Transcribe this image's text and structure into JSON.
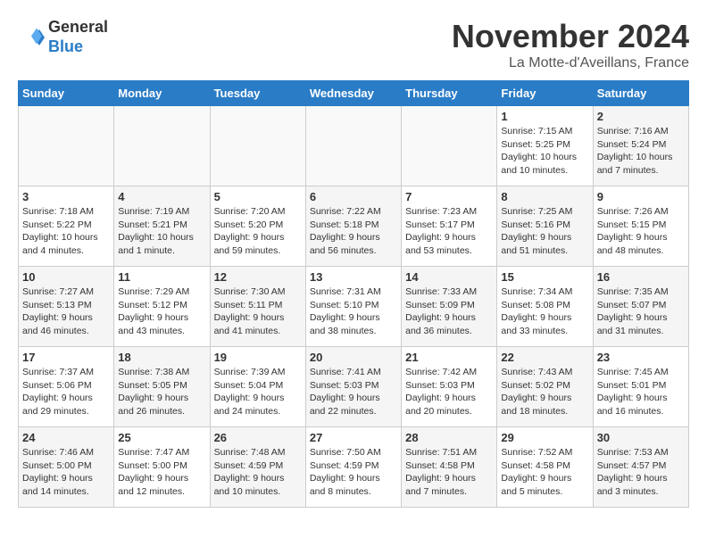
{
  "logo": {
    "general": "General",
    "blue": "Blue"
  },
  "title": "November 2024",
  "subtitle": "La Motte-d'Aveillans, France",
  "days_of_week": [
    "Sunday",
    "Monday",
    "Tuesday",
    "Wednesday",
    "Thursday",
    "Friday",
    "Saturday"
  ],
  "weeks": [
    [
      {
        "num": "",
        "info": "",
        "empty": true
      },
      {
        "num": "",
        "info": "",
        "empty": true
      },
      {
        "num": "",
        "info": "",
        "empty": true
      },
      {
        "num": "",
        "info": "",
        "empty": true
      },
      {
        "num": "",
        "info": "",
        "empty": true
      },
      {
        "num": "1",
        "info": "Sunrise: 7:15 AM\nSunset: 5:25 PM\nDaylight: 10 hours and 10 minutes."
      },
      {
        "num": "2",
        "info": "Sunrise: 7:16 AM\nSunset: 5:24 PM\nDaylight: 10 hours and 7 minutes."
      }
    ],
    [
      {
        "num": "3",
        "info": "Sunrise: 7:18 AM\nSunset: 5:22 PM\nDaylight: 10 hours and 4 minutes."
      },
      {
        "num": "4",
        "info": "Sunrise: 7:19 AM\nSunset: 5:21 PM\nDaylight: 10 hours and 1 minute."
      },
      {
        "num": "5",
        "info": "Sunrise: 7:20 AM\nSunset: 5:20 PM\nDaylight: 9 hours and 59 minutes."
      },
      {
        "num": "6",
        "info": "Sunrise: 7:22 AM\nSunset: 5:18 PM\nDaylight: 9 hours and 56 minutes."
      },
      {
        "num": "7",
        "info": "Sunrise: 7:23 AM\nSunset: 5:17 PM\nDaylight: 9 hours and 53 minutes."
      },
      {
        "num": "8",
        "info": "Sunrise: 7:25 AM\nSunset: 5:16 PM\nDaylight: 9 hours and 51 minutes."
      },
      {
        "num": "9",
        "info": "Sunrise: 7:26 AM\nSunset: 5:15 PM\nDaylight: 9 hours and 48 minutes."
      }
    ],
    [
      {
        "num": "10",
        "info": "Sunrise: 7:27 AM\nSunset: 5:13 PM\nDaylight: 9 hours and 46 minutes."
      },
      {
        "num": "11",
        "info": "Sunrise: 7:29 AM\nSunset: 5:12 PM\nDaylight: 9 hours and 43 minutes."
      },
      {
        "num": "12",
        "info": "Sunrise: 7:30 AM\nSunset: 5:11 PM\nDaylight: 9 hours and 41 minutes."
      },
      {
        "num": "13",
        "info": "Sunrise: 7:31 AM\nSunset: 5:10 PM\nDaylight: 9 hours and 38 minutes."
      },
      {
        "num": "14",
        "info": "Sunrise: 7:33 AM\nSunset: 5:09 PM\nDaylight: 9 hours and 36 minutes."
      },
      {
        "num": "15",
        "info": "Sunrise: 7:34 AM\nSunset: 5:08 PM\nDaylight: 9 hours and 33 minutes."
      },
      {
        "num": "16",
        "info": "Sunrise: 7:35 AM\nSunset: 5:07 PM\nDaylight: 9 hours and 31 minutes."
      }
    ],
    [
      {
        "num": "17",
        "info": "Sunrise: 7:37 AM\nSunset: 5:06 PM\nDaylight: 9 hours and 29 minutes."
      },
      {
        "num": "18",
        "info": "Sunrise: 7:38 AM\nSunset: 5:05 PM\nDaylight: 9 hours and 26 minutes."
      },
      {
        "num": "19",
        "info": "Sunrise: 7:39 AM\nSunset: 5:04 PM\nDaylight: 9 hours and 24 minutes."
      },
      {
        "num": "20",
        "info": "Sunrise: 7:41 AM\nSunset: 5:03 PM\nDaylight: 9 hours and 22 minutes."
      },
      {
        "num": "21",
        "info": "Sunrise: 7:42 AM\nSunset: 5:03 PM\nDaylight: 9 hours and 20 minutes."
      },
      {
        "num": "22",
        "info": "Sunrise: 7:43 AM\nSunset: 5:02 PM\nDaylight: 9 hours and 18 minutes."
      },
      {
        "num": "23",
        "info": "Sunrise: 7:45 AM\nSunset: 5:01 PM\nDaylight: 9 hours and 16 minutes."
      }
    ],
    [
      {
        "num": "24",
        "info": "Sunrise: 7:46 AM\nSunset: 5:00 PM\nDaylight: 9 hours and 14 minutes."
      },
      {
        "num": "25",
        "info": "Sunrise: 7:47 AM\nSunset: 5:00 PM\nDaylight: 9 hours and 12 minutes."
      },
      {
        "num": "26",
        "info": "Sunrise: 7:48 AM\nSunset: 4:59 PM\nDaylight: 9 hours and 10 minutes."
      },
      {
        "num": "27",
        "info": "Sunrise: 7:50 AM\nSunset: 4:59 PM\nDaylight: 9 hours and 8 minutes."
      },
      {
        "num": "28",
        "info": "Sunrise: 7:51 AM\nSunset: 4:58 PM\nDaylight: 9 hours and 7 minutes."
      },
      {
        "num": "29",
        "info": "Sunrise: 7:52 AM\nSunset: 4:58 PM\nDaylight: 9 hours and 5 minutes."
      },
      {
        "num": "30",
        "info": "Sunrise: 7:53 AM\nSunset: 4:57 PM\nDaylight: 9 hours and 3 minutes."
      }
    ]
  ]
}
